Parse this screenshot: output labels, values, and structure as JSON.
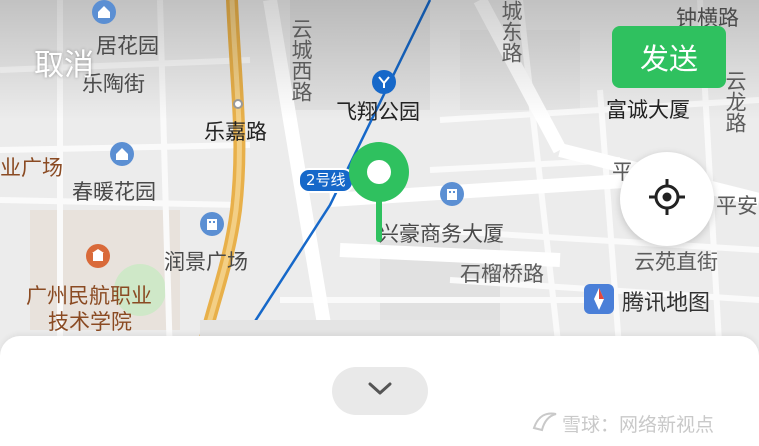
{
  "header": {
    "cancel_label": "取消",
    "send_label": "发送"
  },
  "map": {
    "labels": {
      "l1": "居花园",
      "l2": "乐陶街",
      "l3": "云城西路",
      "l4": "乐嘉路",
      "l5": "飞翔公园",
      "l6": "城东路",
      "l7": "钟横路",
      "l8": "富诚大厦",
      "l9": "云龙路",
      "l10": "业广场",
      "l11": "春暖花园",
      "l12": "兴豪商务大厦",
      "l13": "润景广场",
      "l14": "石榴桥路",
      "l15": "云苑直街",
      "l16": "平安",
      "l17": "平",
      "l18": "广州民航职业",
      "l19": "技术学院"
    },
    "line_badge": "2号线",
    "provider": "腾讯地图"
  },
  "watermark": {
    "text": "雪球：网络新视点"
  },
  "icons": {
    "locate": "crosshair-icon",
    "collapse": "chevron-down-icon",
    "pin": "location-pin-icon",
    "metro": "metro-station-icon"
  },
  "colors": {
    "accent": "#2fc15f",
    "metro_line": "#1668c9",
    "poi_blue": "#5b8fd3",
    "highway": "#e8b04a"
  }
}
